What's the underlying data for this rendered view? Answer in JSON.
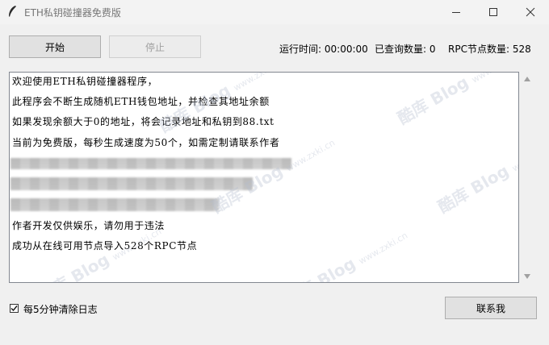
{
  "window": {
    "title": "ETH私钥碰撞器免费版",
    "icon": "feather-icon"
  },
  "toolbar": {
    "start_label": "开始",
    "stop_label": "停止"
  },
  "status": {
    "runtime_label": "运行时间:",
    "runtime_value": "00:00:00",
    "queried_label": "已查询数量:",
    "queried_value": "0",
    "rpc_label": "RPC节点数量:",
    "rpc_value": "528"
  },
  "log": {
    "lines": [
      "欢迎使用ETH私钥碰撞器程序，",
      "此程序会不断生成随机ETH钱包地址，并检查其地址余额",
      "如果发现余额大于0的地址，将会记录地址和私钥到88.txt",
      "当前为免费版，每秒生成速度为50个，如需定制请联系作者",
      "",
      "",
      "",
      "作者开发仅供娱乐，请勿用于违法",
      "成功从在线可用节点导入528个RPC节点"
    ]
  },
  "watermark": {
    "brand": "酷库 Blog",
    "url": "www.zxki.cn"
  },
  "footer": {
    "clear_log_label": "每5分钟清除日志",
    "clear_log_checked": true,
    "contact_label": "联系我"
  }
}
